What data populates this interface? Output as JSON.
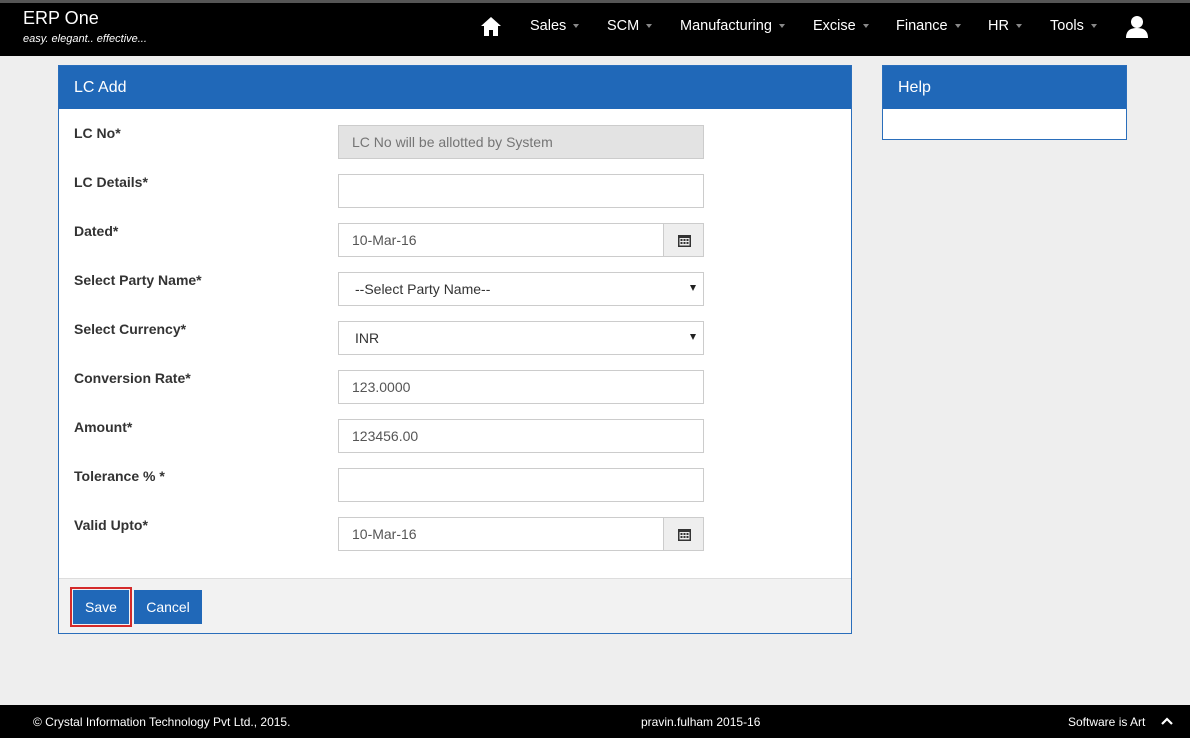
{
  "app": {
    "title": "ERP One",
    "tagline": "easy. elegant.. effective..."
  },
  "nav": {
    "items": [
      {
        "label": "Sales"
      },
      {
        "label": "SCM"
      },
      {
        "label": "Manufacturing"
      },
      {
        "label": "Excise"
      },
      {
        "label": "Finance"
      },
      {
        "label": "HR"
      },
      {
        "label": "Tools"
      }
    ]
  },
  "form": {
    "title": "LC Add",
    "lc_no": {
      "label": "LC No*",
      "placeholder": "LC No will be allotted by System"
    },
    "lc_details": {
      "label": "LC Details*",
      "value": ""
    },
    "dated": {
      "label": "Dated*",
      "value": "10-Mar-16"
    },
    "party": {
      "label": "Select Party Name*",
      "value": "--Select Party Name--"
    },
    "currency": {
      "label": "Select Currency*",
      "value": "INR"
    },
    "conversion_rate": {
      "label": "Conversion Rate*",
      "value": "123.0000"
    },
    "amount": {
      "label": "Amount*",
      "value": "123456.00"
    },
    "tolerance": {
      "label": "Tolerance % *",
      "value": ""
    },
    "valid_upto": {
      "label": "Valid Upto*",
      "value": "10-Mar-16"
    },
    "save_label": "Save",
    "cancel_label": "Cancel"
  },
  "help": {
    "title": "Help"
  },
  "footer": {
    "copyright": "© Crystal Information Technology Pvt Ltd., 2015.",
    "user": "pravin.fulham 2015-16",
    "slogan": "Software is Art"
  },
  "colors": {
    "accent": "#2068b8",
    "nav_bg": "#000000",
    "highlight": "#d42a2a"
  }
}
